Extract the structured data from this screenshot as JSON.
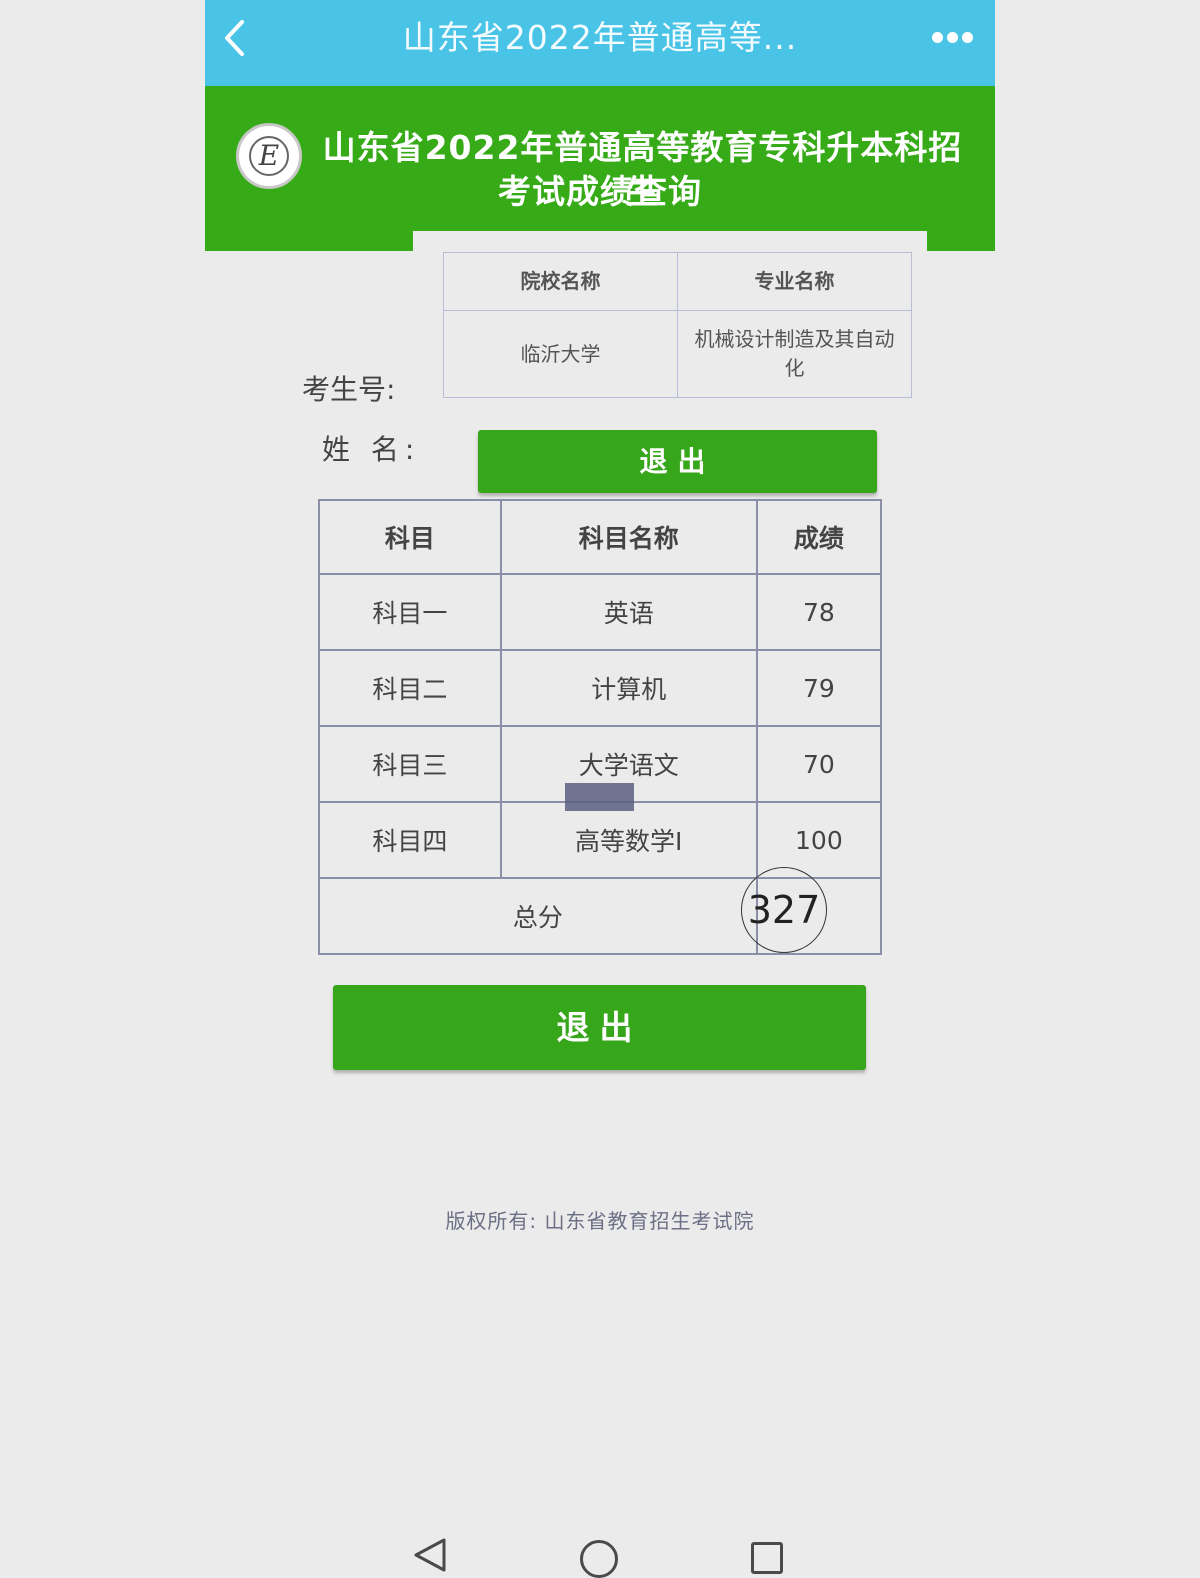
{
  "nav": {
    "title": "山东省2022年普通高等..."
  },
  "header": {
    "title_line1": "山东省2022年普通高等教育专科升本科招生",
    "title_line2": "考试成绩查询",
    "logo_letter": "E"
  },
  "college": {
    "headers": [
      "院校名称",
      "专业名称"
    ],
    "school": "临沂大学",
    "major": "机械设计制造及其自动化"
  },
  "labels": {
    "exam_no": "考生号:",
    "name": "姓 名:"
  },
  "buttons": {
    "logout": "退出"
  },
  "scores": {
    "headers": [
      "科目",
      "科目名称",
      "成绩"
    ],
    "rows": [
      {
        "subject": "科目一",
        "name": "英语",
        "score": "78"
      },
      {
        "subject": "科目二",
        "name": "计算机",
        "score": "79"
      },
      {
        "subject": "科目三",
        "name": "大学语文",
        "score": "70"
      },
      {
        "subject": "科目四",
        "name": "高等数学I",
        "score": "100"
      }
    ],
    "total_label": "总分",
    "total_value": "327"
  },
  "footer": {
    "copyright": "版权所有: 山东省教育招生考试院"
  },
  "icons": [
    "back-icon",
    "more-icon",
    "nav-back-icon",
    "nav-home-icon",
    "nav-recent-icon"
  ],
  "colors": {
    "top_bar": "#4ac4e6",
    "header_green": "#36aa17",
    "button_green": "#36a61a",
    "background": "#ebebeb"
  }
}
